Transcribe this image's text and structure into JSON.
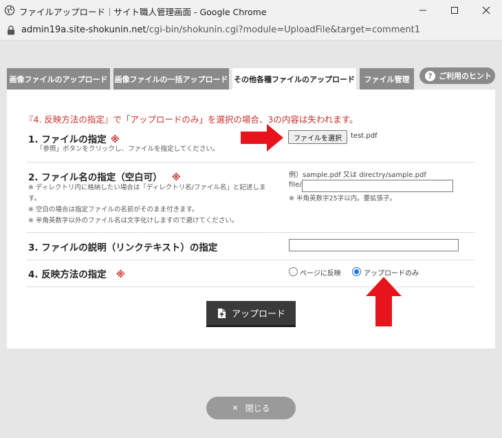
{
  "window": {
    "title": "ファイルアップロード｜サイト職人管理画面 - Google Chrome",
    "url_host": "admin19a.site-shokunin.net",
    "url_path": "/cgi-bin/shokunin.cgi?module=UploadFile&target=comment1"
  },
  "tabs": [
    {
      "label": "画像ファイルのアップロード",
      "active": false
    },
    {
      "label": "画像ファイルの一括アップロード",
      "active": false
    },
    {
      "label": "その他各種ファイルのアップロード",
      "active": true
    },
    {
      "label": "ファイル管理",
      "active": false
    }
  ],
  "hint_label": "ご利用のヒント",
  "notice": "『4. 反映方法の指定』で「アップロードのみ」を選択の場合、3の内容は失われます。",
  "required_mark": "※",
  "section1": {
    "label": "1. ファイルの指定",
    "note": "「参照」ボタンをクリックし、ファイルを指定してください。",
    "button": "ファイルを選択",
    "file_name": "test.pdf"
  },
  "section2": {
    "label": "2. ファイル名の指定（空白可）",
    "notes": [
      "※ ディレクトリ内に格納したい場合は「ディレクトリ名/ファイル名」と記述します。",
      "※ 空白の場合は指定ファイルの名前がそのまま付きます。",
      "※ 半角英数字以外のファイル名は文字化けしますので避けてください。"
    ],
    "example": "例）sample.pdf 又は directry/sample.pdf",
    "prefix": "file/",
    "value": "",
    "subnote": "※ 半角英数字25字以内。要拡張子。"
  },
  "section3": {
    "label": "3. ファイルの説明（リンクテキスト）の指定",
    "value": ""
  },
  "section4": {
    "label": "4. 反映方法の指定",
    "options": [
      {
        "label": "ページに反映",
        "checked": false
      },
      {
        "label": "アップロードのみ",
        "checked": true
      }
    ]
  },
  "upload_button": "アップロード",
  "close_button": "閉じる",
  "colors": {
    "accent_red": "#c9302c",
    "annotation_arrow": "#e8141c",
    "tab_gray": "#8a8a8a",
    "button_dark": "#3a3a3a"
  }
}
